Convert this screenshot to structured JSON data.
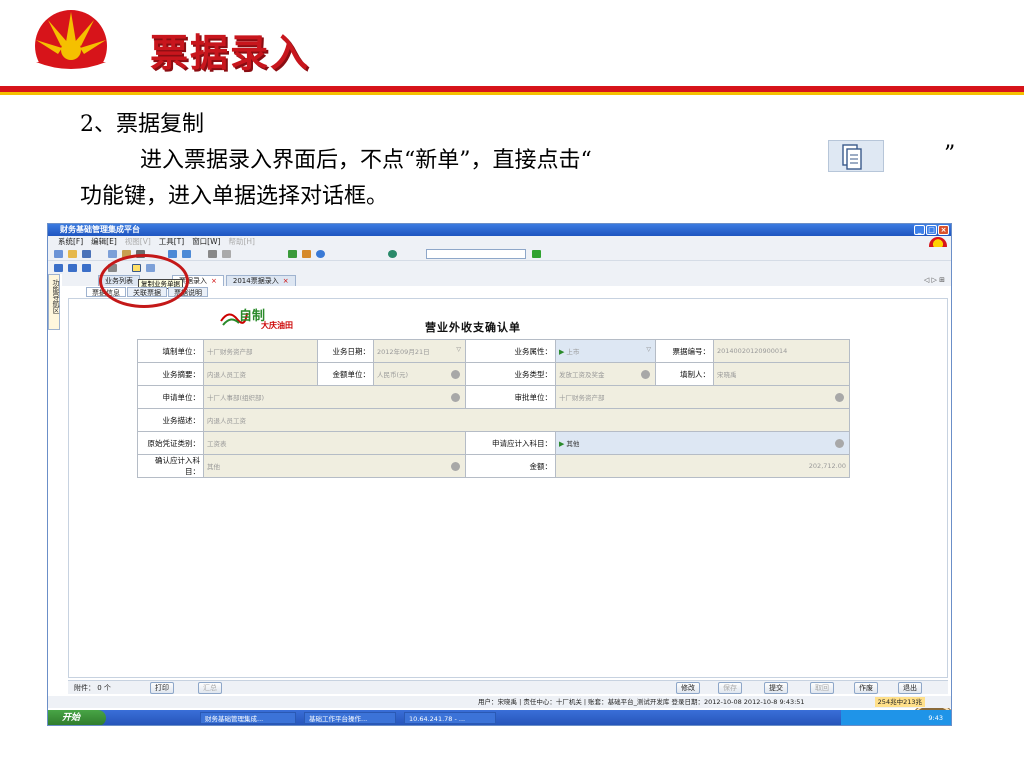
{
  "slide": {
    "title": "票据录入",
    "step": "2、票据复制",
    "desc_line1": "进入票据录入界面后，不点“新单”，直接点击“",
    "desc_close": "”",
    "desc_line2": "功能键，进入单据选择对话框。"
  },
  "window": {
    "title": "财务基础管理集成平台",
    "menu": [
      "系统[F]",
      "编辑[E]",
      "视图[V]",
      "工具[T]",
      "窗口[W]",
      "帮助[H]"
    ],
    "sidebar_label": "功能导航区",
    "tooltip": "复制业务单据",
    "tabs": [
      {
        "label": "业务列表"
      },
      {
        "label": "票据录入",
        "close": "×"
      },
      {
        "label": "2014票据录入",
        "close": "×"
      }
    ],
    "subtabs": [
      "票据信息",
      "关联票据",
      "票据说明"
    ],
    "nav_arrows": "◁ ▷ ⊞",
    "form": {
      "logo_text": "自制",
      "logo_sub": "大庆油田",
      "title": "营业外收支确认单",
      "row1": {
        "l1": "填制单位：",
        "v1": "十厂财务资产部",
        "l2": "业务日期：",
        "v2": "2012年09月21日",
        "l3": "业务属性：",
        "v3": "上市",
        "l4": "票据编号：",
        "v4": "20140020120900014"
      },
      "row2": {
        "l1": "业务摘要：",
        "v1": "内退人员工资",
        "l2": "金额单位：",
        "v2": "人民币(元)",
        "l3": "业务类型：",
        "v3": "发放工资及奖金",
        "l4": "填制人：",
        "v4": "宋晓禹"
      },
      "row3": {
        "l1": "申请单位：",
        "v1": "十厂人事部(组织部)",
        "l2": "审批单位：",
        "v2": "十厂财务资产部"
      },
      "row4": {
        "l1": "业务描述：",
        "v1": "内退人员工资"
      },
      "row5": {
        "l1": "原始凭证类别：",
        "v1": "工资表",
        "l2": "申请应计入科目：",
        "v2": "其他"
      },
      "row6": {
        "l1": "确认应计入科目：",
        "v1": "其他",
        "l2": "金额：",
        "v2": "202,712.00"
      }
    },
    "bottom": {
      "attach": "附件：  0 个",
      "print": "打印",
      "summary": "汇总",
      "edit": "修改",
      "save": "保存",
      "submit": "提交",
      "undo": "取回",
      "void": "作废",
      "exit": "退出"
    },
    "status": "用户：宋晓禹 | 责任中心：十厂机关 | 账套：基础平台_测试开发库  登录日期：2012-10-08   2012-10-8 9:43:51",
    "status_counter": "254兆中213兆",
    "taskbar": {
      "start": "开始",
      "items": [
        "财务基础管理集成...",
        "基础工作平台操作...",
        "10.64.241.78 - ..."
      ],
      "clock": "9:43"
    }
  },
  "colors": {
    "title_red": "#c8161d",
    "bar_red": "#d7141a",
    "bar_yellow": "#f5c000",
    "window_blue": "#1f55c0",
    "circle_red": "#c41818"
  }
}
